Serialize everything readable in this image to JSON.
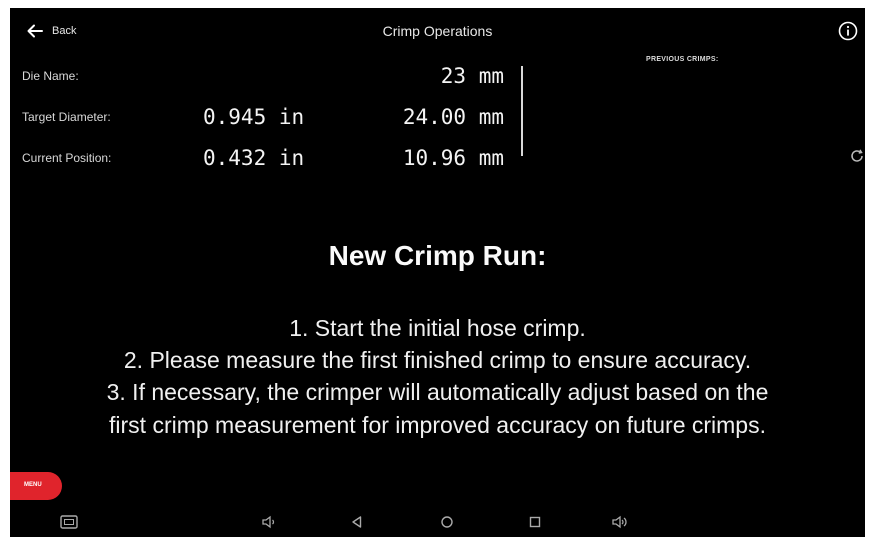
{
  "header": {
    "back_label": "Back",
    "title": "Crimp Operations",
    "info_icon": "info-icon"
  },
  "fields": {
    "die_name_label": "Die Name:",
    "die_name_mm": "23 mm",
    "target_label": "Target Diameter:",
    "target_in": "0.945 in",
    "target_mm": "24.00 mm",
    "current_label": "Current Position:",
    "current_in": "0.432 in",
    "current_mm": "10.96 mm"
  },
  "previous_crimps_label": "PREVIOUS CRIMPS:",
  "main": {
    "heading": "New Crimp Run:",
    "lines": [
      "1. Start the initial hose crimp.",
      "2. Please measure the first finished crimp to ensure accuracy.",
      "3. If necessary, the crimper will automatically adjust based on the",
      "first crimp measurement for improved accuracy on future crimps."
    ]
  },
  "menu_label": "MENU",
  "navbar": [
    "screenshot-icon",
    "volume-down-icon",
    "back-icon",
    "home-icon",
    "recents-icon",
    "volume-up-icon"
  ],
  "colors": {
    "background": "#000000",
    "text": "#ffffff",
    "menu": "#e0242c"
  }
}
